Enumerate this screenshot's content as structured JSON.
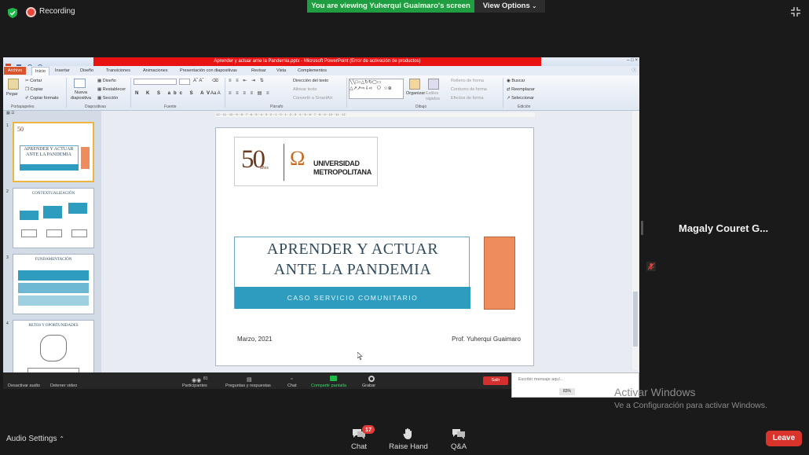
{
  "top": {
    "recording_label": "Recording",
    "viewing_banner": "You are viewing Yuherqui Guaimaro's screen",
    "view_options": "View Options"
  },
  "ppt": {
    "window_title": "Aprender y actuar ante la Pandemia.pptx - Microsoft PowerPoint (Error de activación de productos)",
    "menu": [
      "Archivo",
      "Inicio",
      "Insertar",
      "Diseño",
      "Transiciones",
      "Animaciones",
      "Presentación con diapositivas",
      "Revisar",
      "Vista",
      "Complementos"
    ],
    "ribbon": {
      "paste": "Pegar",
      "cut": "Cortar",
      "copy": "Copiar",
      "format_painter": "Copiar formato",
      "new_slide": "Nueva diapositiva",
      "layout": "Diseño",
      "reset": "Restablecer",
      "section": "Sección",
      "text_direction": "Dirección del texto",
      "align_text": "Alinear texto",
      "smartart": "Convertir a SmartArt",
      "arrange": "Organizar",
      "quick_styles": "Estilos rápidos",
      "shape_fill": "Relleno de forma",
      "shape_outline": "Contorno de forma",
      "shape_effects": "Efectos de forma",
      "find": "Buscar",
      "replace": "Reemplazar",
      "select": "Seleccionar",
      "groups": {
        "clipboard": "Portapapeles",
        "slides": "Diapositivas",
        "font": "Fuente",
        "paragraph": "Párrafo",
        "drawing": "Dibujo",
        "editing": "Edición"
      }
    },
    "ruler_text": "·12···11···10···9···8···7···6···5···4···3···2···1···0···1···2···3···4···5···6···7···8···9···10···11···12·",
    "thumbs": [
      {
        "num": "1",
        "title": "APRENDER Y ACTUAR ANTE LA PANDEMIA"
      },
      {
        "num": "2",
        "title": "CONTEXTUALIZACIÓN"
      },
      {
        "num": "3",
        "title": "FUNDAMENTACIÓN"
      },
      {
        "num": "4",
        "title": "RETOS Y OPORTUNIDADES"
      }
    ],
    "slide": {
      "logo_50": "50",
      "logo_anos": "años",
      "logo_line1": "UNIVERSIDAD",
      "logo_line2": "METROPOLITANA",
      "title_line1": "APRENDER Y ACTUAR",
      "title_line2": "ANTE LA PANDEMIA",
      "subtitle": "CASO SERVICIO COMUNITARIO",
      "date": "Marzo, 2021",
      "author": "Prof. Yuherqui Guaimaro"
    },
    "share_controls": {
      "mute": "Desactivar audio",
      "stop_video": "Detener video",
      "participants": "Participantes",
      "participants_count": "81",
      "qa": "Preguntas y respuestas",
      "chat": "Chat",
      "share": "Compartir pantalla",
      "record": "Grabar",
      "leave": "Salir"
    },
    "chat_box": {
      "placeholder": "Escribir mensaje aquí...",
      "zoom": "83%"
    }
  },
  "participant": {
    "name": "Magaly Couret G..."
  },
  "watermark": {
    "line1": "Activar Windows",
    "line2": "Ve a Configuración para activar Windows."
  },
  "toolbar": {
    "audio_settings": "Audio Settings",
    "chat": "Chat",
    "chat_badge": "17",
    "raise_hand": "Raise Hand",
    "qa": "Q&A",
    "leave": "Leave"
  },
  "colors": {
    "banner_green": "#1f9e41",
    "leave_red": "#d8342c",
    "slide_blue": "#2e9cbf",
    "slide_orange": "#ef8c5c"
  }
}
